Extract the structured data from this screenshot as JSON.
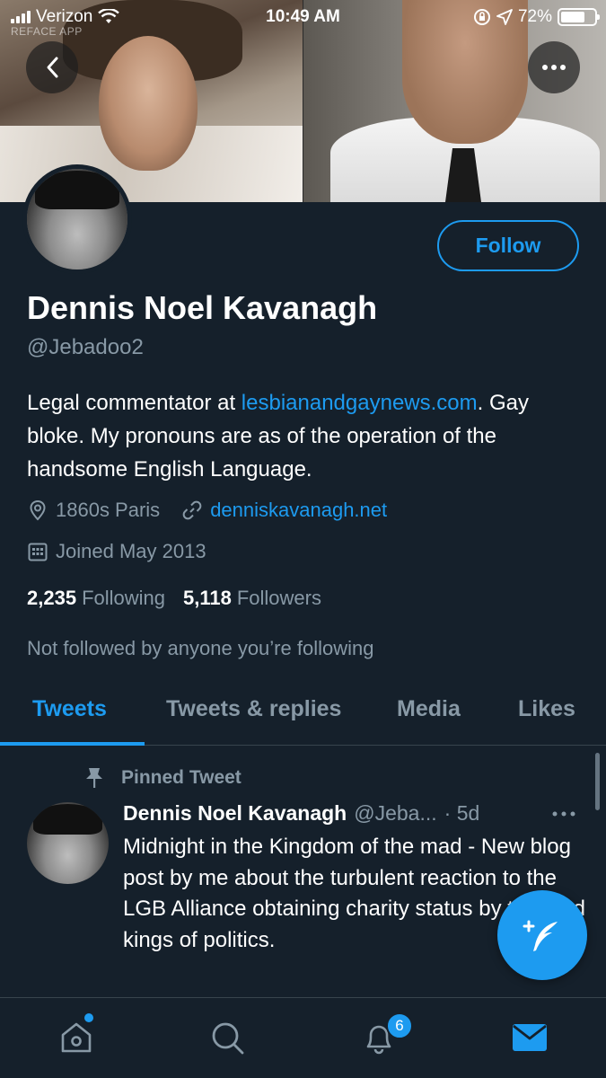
{
  "status_bar": {
    "carrier": "Verizon",
    "time": "10:49 AM",
    "battery": "72%",
    "watermark": "REFACE APP"
  },
  "profile": {
    "name": "Dennis Noel Kavanagh",
    "handle": "@Jebadoo2",
    "follow_label": "Follow",
    "bio_prefix": "Legal commentator at ",
    "bio_link": "lesbianandgaynews.com",
    "bio_suffix": ". Gay bloke. My pronouns are as of the operation of the handsome English Language.",
    "location": "1860s Paris",
    "website": "denniskavanagh.net",
    "joined": "Joined May 2013",
    "following_count": "2,235",
    "following_label": "Following",
    "followers_count": "5,118",
    "followers_label": "Followers",
    "not_followed": "Not followed by anyone you’re following"
  },
  "tabs": [
    {
      "label": "Tweets",
      "active": true
    },
    {
      "label": "Tweets & replies",
      "active": false
    },
    {
      "label": "Media",
      "active": false
    },
    {
      "label": "Likes",
      "active": false
    }
  ],
  "tweet": {
    "pinned_label": "Pinned Tweet",
    "author": "Dennis Noel Kavanagh",
    "handle": "@Jeba...",
    "time": "· 5d",
    "text": "Midnight in the Kingdom of the mad - New blog post by me about the turbulent reaction to the LGB Alliance obtaining charity status by the mad kings of politics."
  },
  "bottom_nav": {
    "notifications_badge": "6",
    "icons": [
      "home-icon",
      "search-icon",
      "notifications-icon",
      "messages-icon"
    ]
  },
  "colors": {
    "background": "#15202b",
    "accent": "#1d9bf0",
    "secondary_text": "#8899a6",
    "border": "#38444d"
  }
}
